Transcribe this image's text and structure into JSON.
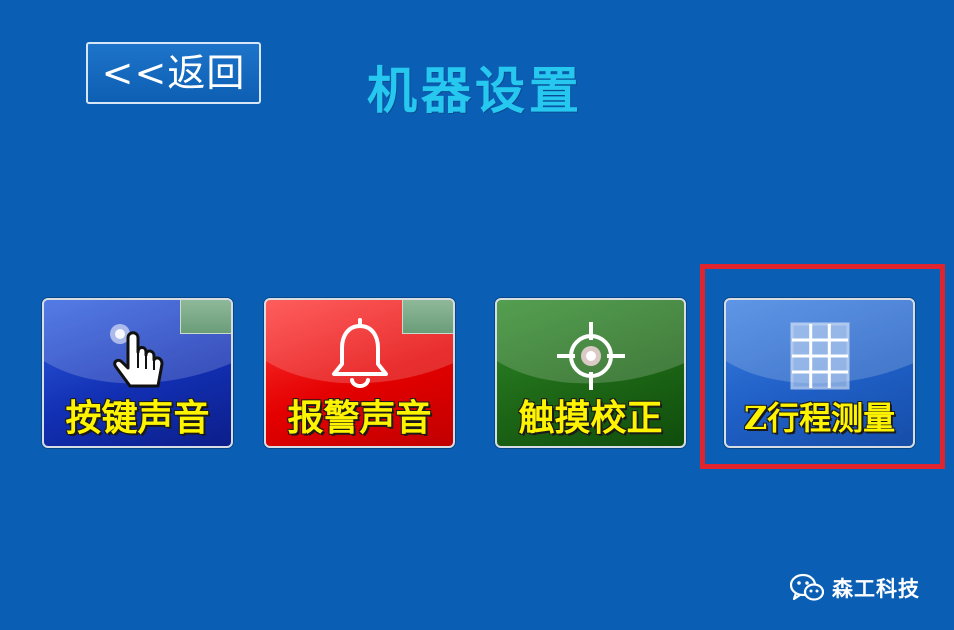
{
  "header": {
    "back_label": "<<返回",
    "title": "机器设置"
  },
  "tiles": [
    {
      "label": "按键声音",
      "icon": "hand-pointer-icon"
    },
    {
      "label": "报警声音",
      "icon": "bell-icon"
    },
    {
      "label": "触摸校正",
      "icon": "crosshair-icon"
    },
    {
      "label": "Z行程测量",
      "icon": "grid-icon"
    }
  ],
  "watermark": {
    "text": "森工科技",
    "icon": "wechat-icon"
  },
  "colors": {
    "background": "#0a5fb5",
    "title": "#27c8f0",
    "tile_label": "#fff400",
    "highlight": "#e0242e"
  }
}
